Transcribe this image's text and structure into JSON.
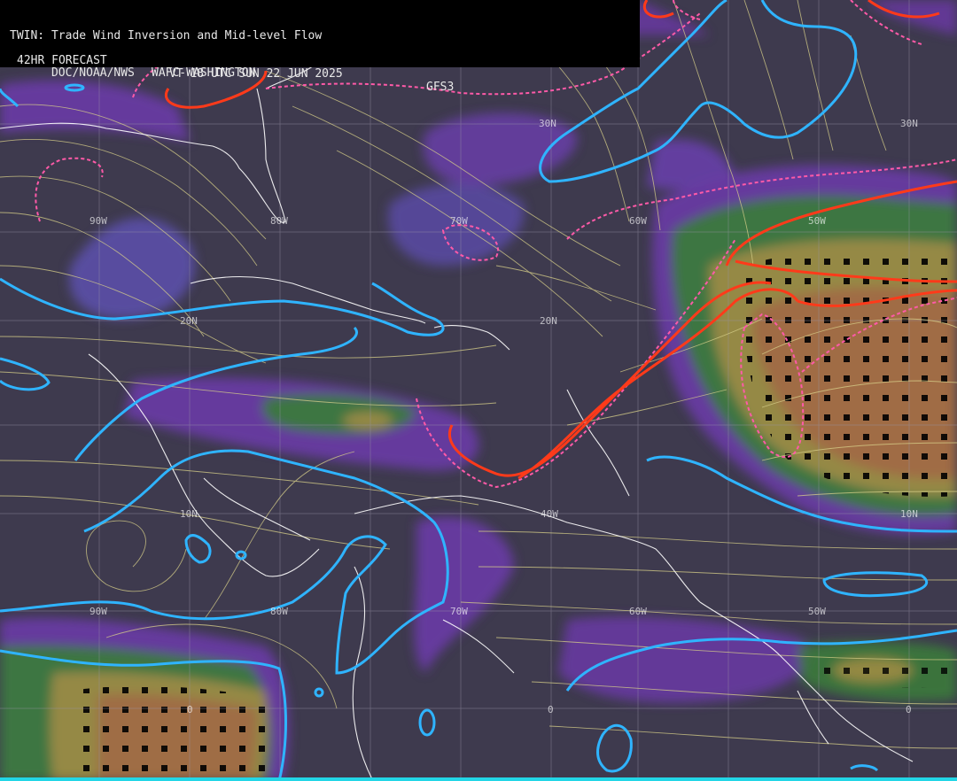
{
  "header": {
    "title": "TWIN: Trade Wind Inversion and Mid-level Flow",
    "forecast": "42HR FORECAST",
    "valid_time": "VT 18 UTC SUN 22 JUN 2025",
    "model": "GFS3",
    "agency": "DOC/NOAA/NWS",
    "center": "WAFC-WASHINGTON"
  },
  "grid_labels": {
    "lat_30n": "30N",
    "lat_20n": "20N",
    "lat_10n": "10N",
    "lat_0": "0",
    "lon_90w": "90W",
    "lon_80w": "80W",
    "lon_70w": "70W",
    "lon_60w": "60W",
    "lon_50w": "50W",
    "lon_40w": "40W"
  },
  "colors": {
    "background": "#3e3a4e",
    "purple_shade": "#7a3fb0",
    "blue_shade": "#4a5aa0",
    "green_shade": "#3c7a3c",
    "tan_shade": "#9a8a45",
    "brown_shade": "#a06a45",
    "streamline": "#d8d08a",
    "cyan_contour": "#2fb4ff",
    "red_contour": "#ff3a1a",
    "pink_dashed": "#ff5aa8",
    "coastline": "#ffffff",
    "grid": "#9a96a8"
  }
}
